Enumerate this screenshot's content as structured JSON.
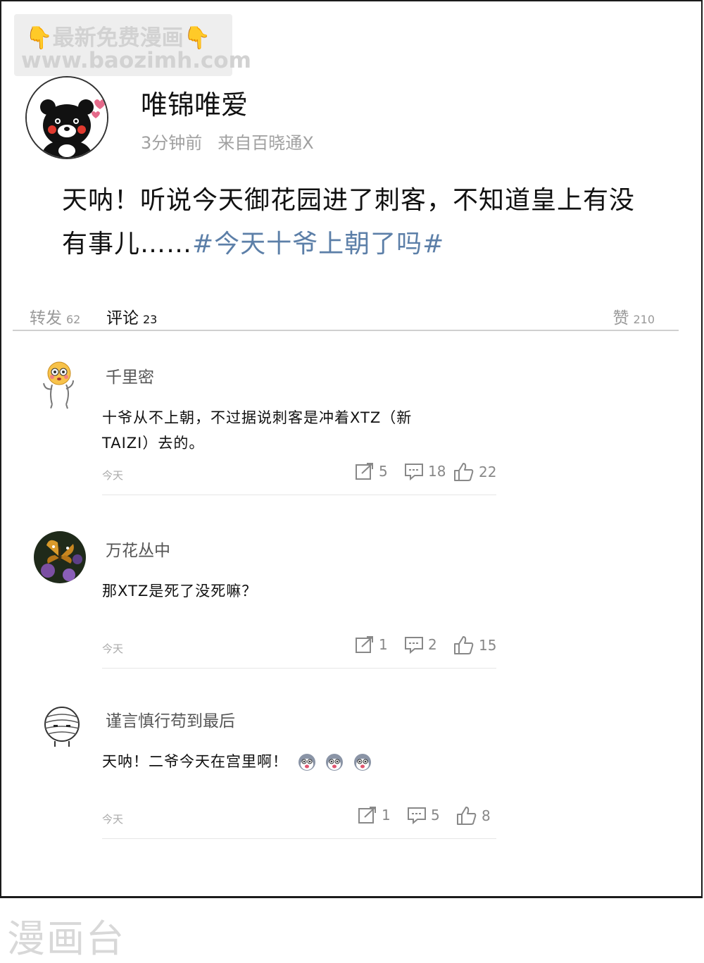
{
  "watermark": {
    "line1": "最新免费漫画",
    "line2": "www.baozimh.com",
    "hand_left": "👇",
    "hand_right": "👇"
  },
  "post": {
    "username": "唯锦唯爱",
    "time": "3分钟前",
    "source": "来自百晓通X",
    "text": "天呐！听说今天御花园进了刺客，不知道皇上有没有事儿……",
    "hashtag": "#今天十爷上朝了吗#"
  },
  "tabs": {
    "repost_label": "转发",
    "repost_count": "62",
    "comment_label": "评论",
    "comment_count": "23",
    "like_label": "赞",
    "like_count": "210"
  },
  "comments": [
    {
      "name": "千里密",
      "text": "十爷从不上朝，不过据说刺客是冲着XTZ（新TAIZI）去的。",
      "time": "今天",
      "reposts": "5",
      "replies": "18",
      "likes": "22"
    },
    {
      "name": "万花丛中",
      "text": "那XTZ是死了没死嘛？",
      "time": "今天",
      "reposts": "1",
      "replies": "2",
      "likes": "15"
    },
    {
      "name": "谨言慎行苟到最后",
      "text": "天呐！二爷今天在宫里啊！",
      "time": "今天",
      "reposts": "1",
      "replies": "5",
      "likes": "8"
    }
  ],
  "footer": {
    "logo": "漫画台"
  },
  "colors": {
    "hashtag": "#5c7fa8",
    "muted": "#999999",
    "divider": "#cfcfcf"
  }
}
